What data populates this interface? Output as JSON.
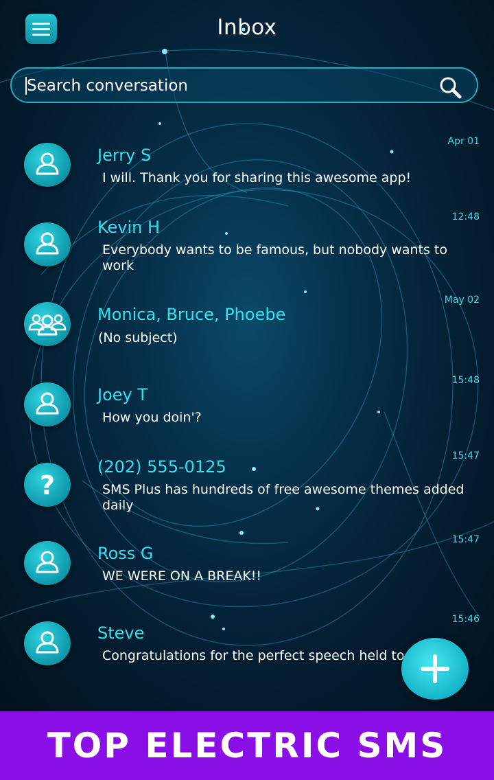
{
  "header": {
    "title": "Inbox",
    "menu_icon": "hamburger-menu-icon"
  },
  "search": {
    "placeholder": "Search conversation",
    "icon": "search-icon"
  },
  "conversations": [
    {
      "name": "Jerry S",
      "message": "I will. Thank you for sharing this awesome app!",
      "time": "Apr 01",
      "avatar": "person-icon"
    },
    {
      "name": "Kevin H",
      "message": "Everybody wants to be famous, but nobody wants to work",
      "time": "12:48",
      "avatar": "person-icon"
    },
    {
      "name": "Monica, Bruce, Phoebe",
      "message": "(No subject)",
      "time": "May 02",
      "avatar": "group-icon"
    },
    {
      "name": "Joey T",
      "message": "How you doin'?",
      "time": "15:48",
      "avatar": "person-icon"
    },
    {
      "name": "(202) 555-0125",
      "message": "SMS Plus has hundreds of free awesome themes added daily",
      "time": "15:47",
      "avatar": "question-mark-icon"
    },
    {
      "name": "Ross G",
      "message": "WE WERE ON A BREAK!!",
      "time": "15:47",
      "avatar": "person-icon"
    },
    {
      "name": "Steve",
      "message": "Congratulations for the perfect speech held toda",
      "time": "15:46",
      "avatar": "person-icon"
    }
  ],
  "fab": {
    "icon": "plus-icon"
  },
  "banner": {
    "text": "TOP ELECTRIC SMS"
  },
  "colors": {
    "accent": "#34e0f0",
    "banner": "#8a0fe6",
    "background": "#041f33"
  }
}
